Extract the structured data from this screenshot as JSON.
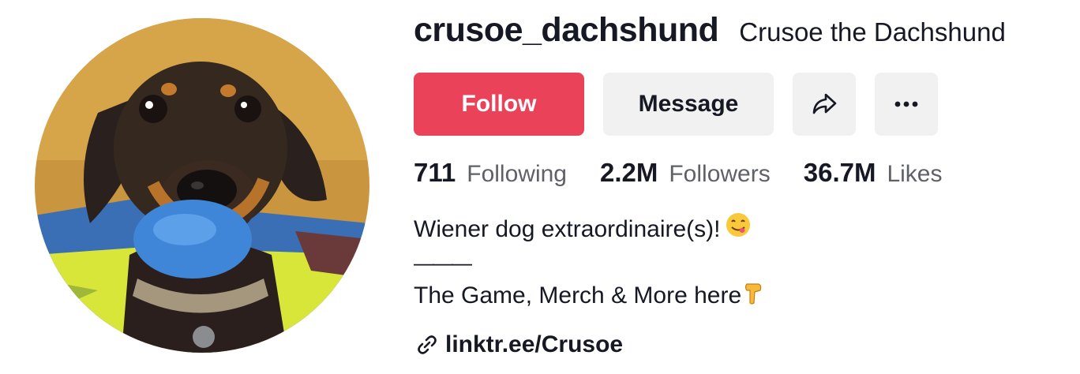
{
  "profile": {
    "username": "crusoe_dachshund",
    "nickname": "Crusoe the Dachshund",
    "avatar_alt": "avatar",
    "buttons": {
      "follow_label": "Follow",
      "message_label": "Message",
      "share_icon": "share-arrow-icon",
      "more_icon": "more-horizontal-icon"
    },
    "stats": [
      {
        "number": "711",
        "label": "Following"
      },
      {
        "number": "2.2M",
        "label": "Followers"
      },
      {
        "number": "36.7M",
        "label": "Likes"
      }
    ],
    "bio": {
      "line1": "Wiener dog extraordinaire(s)!",
      "line1_emoji": "face-savoring-food-emoji",
      "divider": "———",
      "line2": "The Game, Merch & More here",
      "line2_emoji": "pointing-down-emoji"
    },
    "link": {
      "icon": "link-icon",
      "text": "linktr.ee/Crusoe"
    }
  },
  "colors": {
    "follow_bg": "#ea4359",
    "secondary_bg": "#f1f1f2",
    "text_primary": "#161823",
    "text_secondary": "#5f6068"
  }
}
